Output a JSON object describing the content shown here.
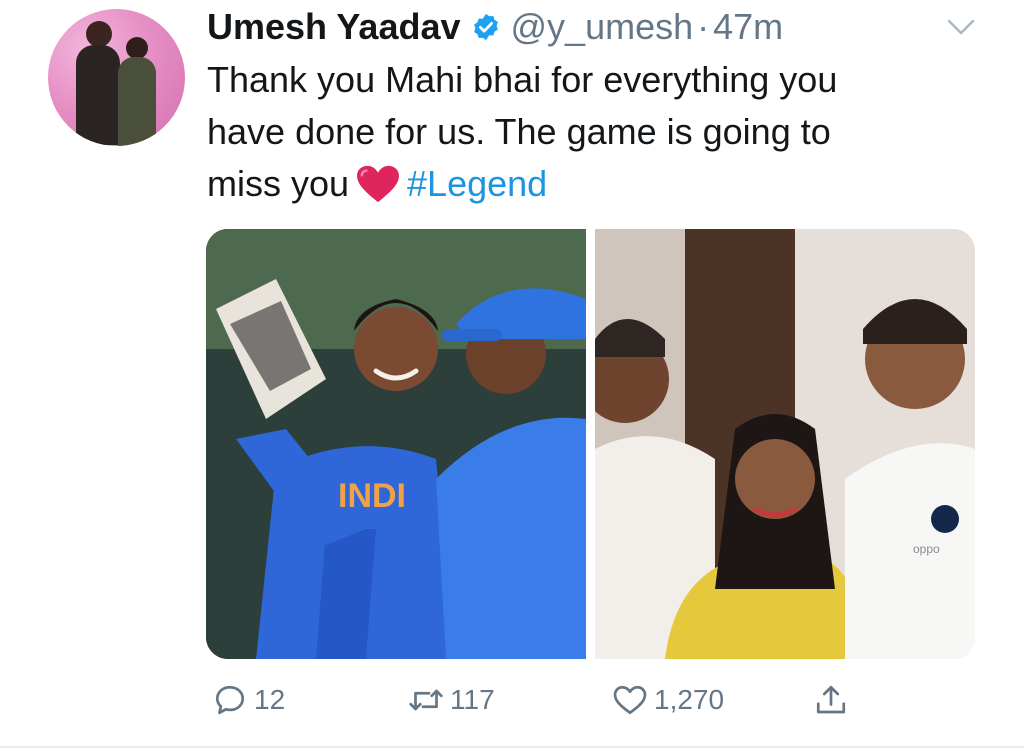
{
  "tweet": {
    "author": {
      "name": "Umesh Yaadav",
      "handle": "@y_umesh",
      "separator": "·",
      "time": "47m",
      "verified": true
    },
    "text_parts": {
      "line1": "Thank you Mahi bhai for everything you",
      "line2": "have done for us.  The game is going to",
      "line3": "miss you",
      "hashtag": "#Legend"
    },
    "emoji": "red-heart",
    "media": [
      {
        "alt": "photo-cricket-celebration"
      },
      {
        "alt": "photo-group"
      }
    ],
    "actions": {
      "replies": "12",
      "retweets": "117",
      "likes": "1,270"
    }
  },
  "colors": {
    "link": "#1b95e0",
    "muted": "#657786",
    "verified": "#1da1f2",
    "heart": "#e0245e"
  }
}
